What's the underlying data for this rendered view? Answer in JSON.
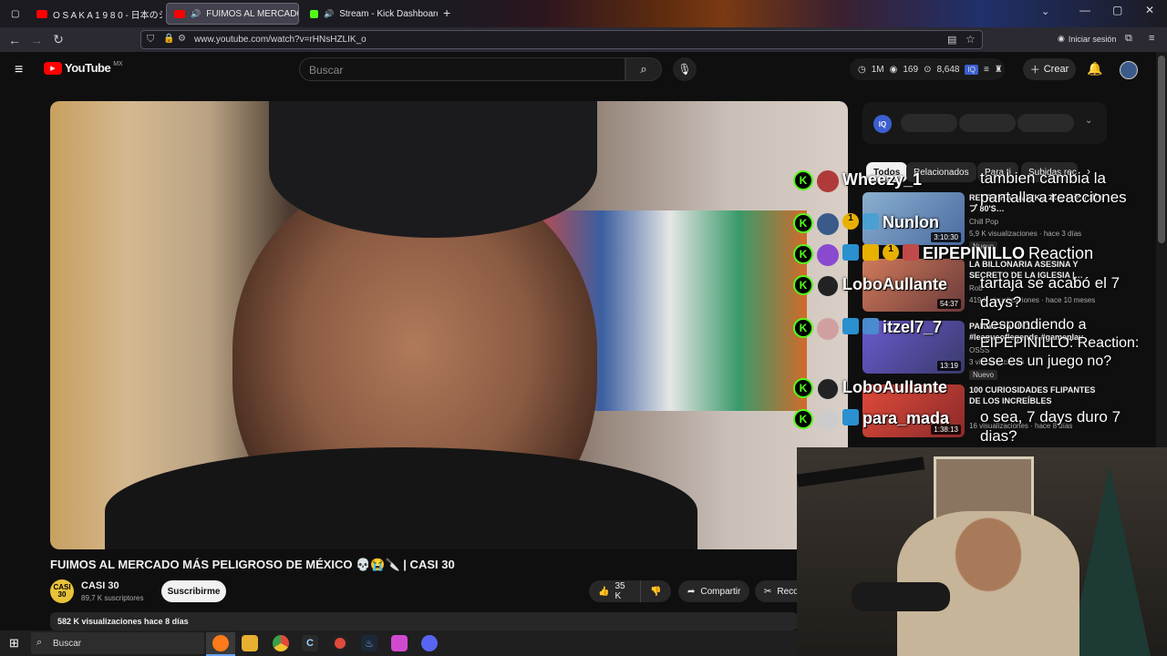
{
  "browser": {
    "tabs": [
      {
        "label": "O S A K A   1 9 8 0 - 日本のシティ",
        "active": false,
        "favicon_color": "#ff0000"
      },
      {
        "label": "FUIMOS AL MERCADO MÁS",
        "active": true,
        "favicon_color": "#ff0000"
      },
      {
        "label": "Stream - Kick Dashboard",
        "active": false,
        "favicon_color": "#53fc18"
      }
    ],
    "url": "www.youtube.com/watch?v=rHNsHZLIK_o",
    "signin_label": "Iniciar sesión"
  },
  "youtube": {
    "logo": "YouTube",
    "region": "MX",
    "search_placeholder": "Buscar",
    "ext_stats": {
      "views": "1M",
      "live": "169",
      "count": "8,648"
    },
    "create_label": "Crear",
    "filter_chips": [
      "Todos",
      "Relacionados",
      "Para ti",
      "Subidas rec"
    ],
    "video_title": "FUIMOS AL MERCADO MÁS PELIGROSO DE MÉXICO 💀😭🔪 | CASI 30",
    "channel": {
      "avatar_text": "CASI 30",
      "name": "CASI 30",
      "subs": "89,7 K suscriptores"
    },
    "subscribe_label": "Suscribirme",
    "likes": "35 K",
    "share_label": "Compartir",
    "recortar_label": "Reco",
    "views_line": "582 K visualizaciones  hace 8 días"
  },
  "recommendations": [
    {
      "title": "RETRO HARAJUKU 本のシティポップ 80'S…",
      "channel": "Chill Pop",
      "meta": "5,9 K visualizaciones · hace 3 días",
      "duration": "3:10:30",
      "badge": "Nuevo",
      "thumb": "#4a6aa0"
    },
    {
      "title": "LA BILLONARIA ASESINA Y SECRETO DE LA IGLESIA |…",
      "channel": "Rob",
      "meta": "419 K visualizaciones · hace 10 meses",
      "duration": "54:37",
      "badge": "",
      "thumb": "#6a3a3a"
    },
    {
      "title": "PARA CUANDO… #leagueoflegends #gameplay",
      "channel": "OSSS",
      "meta": "3 visualizaciones",
      "duration": "13:19",
      "badge": "Nuevo",
      "thumb": "#3a3a6a"
    },
    {
      "title": "100 CURIOSIDADES FLIPANTES DE LOS INCREÍBLES",
      "channel": "JW",
      "meta": "16 visualizaciones · hace 8 días",
      "duration": "1:38:13",
      "badge": "",
      "thumb": "#8a2a2a"
    }
  ],
  "chat": [
    {
      "user": "Wheezy_1",
      "message": "tambien cambia la pantalla a reacciones",
      "avatar": "#b03a3a"
    },
    {
      "user": "Nunlon",
      "message": "",
      "avatar": "#3a5a8a",
      "badge_color": "#e8b000"
    },
    {
      "user": "EIPEPINILLO",
      "message": "Reaction",
      "avatar": "#8a4ad0",
      "badge_color": "#e8b000"
    },
    {
      "user": "LoboAullante",
      "message": "tartaja se acabó el 7 days?",
      "avatar": "#222222"
    },
    {
      "user": "itzel7_7",
      "message": "Respondiendo a EIPEPINILLO: Reaction:  ese es un juego no?",
      "avatar": "#d0a0a0"
    },
    {
      "user": "LoboAullante",
      "message": "",
      "avatar": "#222222"
    },
    {
      "user": "para_mada",
      "message": "o sea, 7 days duro 7 dias?",
      "avatar": "#cccccc"
    }
  ],
  "taskbar": {
    "search_label": "Buscar"
  },
  "colors": {
    "accent_red": "#ff0000",
    "kick_green": "#53fc18"
  }
}
